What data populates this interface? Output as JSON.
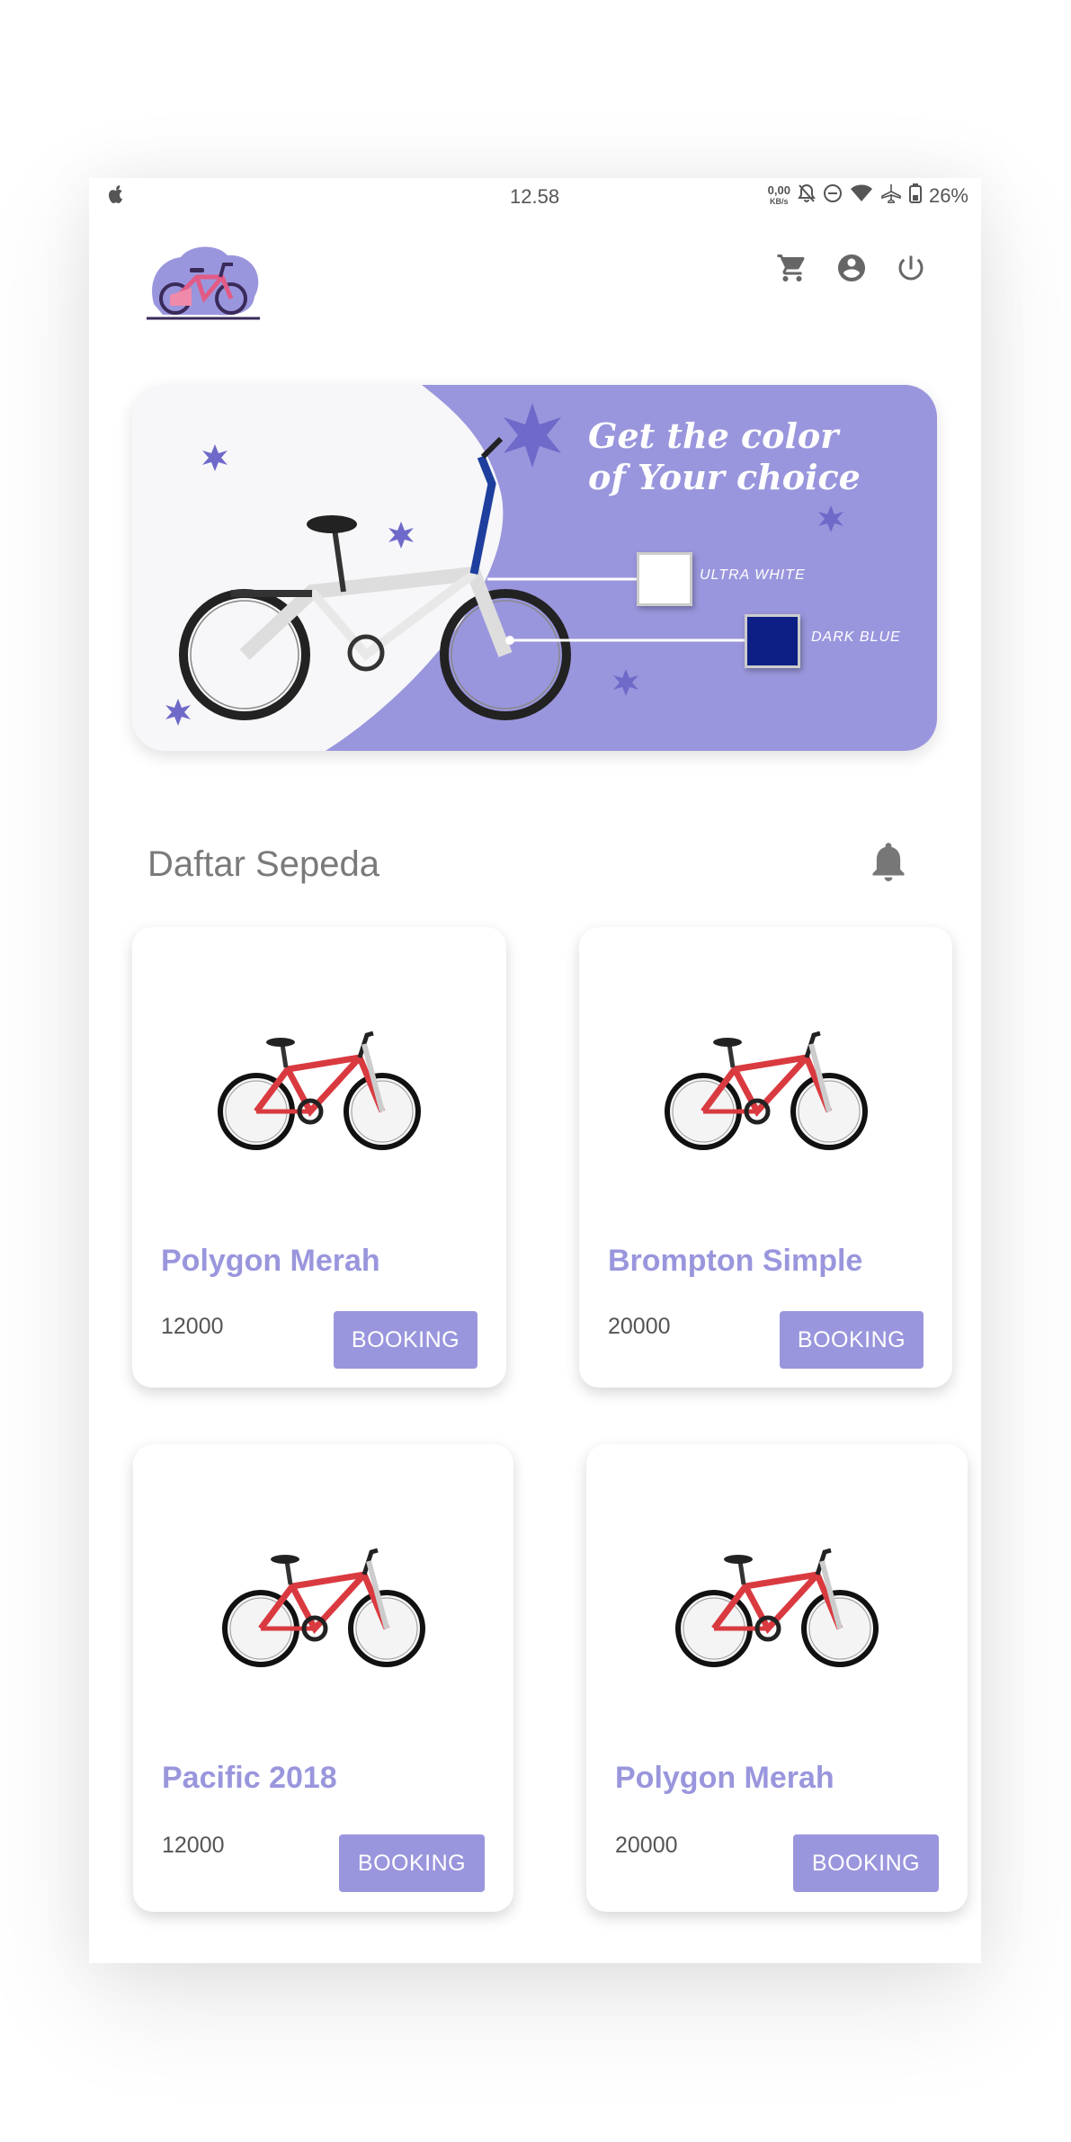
{
  "status_bar": {
    "time": "12.58",
    "net_speed_value": "0,00",
    "net_speed_unit": "KB/s",
    "battery": "26%"
  },
  "header": {
    "icons": [
      "cart-icon",
      "account-icon",
      "power-icon"
    ]
  },
  "banner": {
    "title_line1": "Get the color",
    "title_line2": "of Your choice",
    "options": [
      {
        "label": "ULTRA WHITE",
        "color": "#ffffff"
      },
      {
        "label": "DARK BLUE",
        "color": "#0d1f85"
      }
    ]
  },
  "section": {
    "title": "Daftar Sepeda"
  },
  "cards": [
    {
      "name": "Polygon Merah",
      "price": "12000",
      "button": "BOOKING"
    },
    {
      "name": "Brompton Simple",
      "price": "20000",
      "button": "BOOKING"
    },
    {
      "name": "Pacific 2018",
      "price": "12000",
      "button": "BOOKING"
    },
    {
      "name": "Polygon Merah",
      "price": "20000",
      "button": "BOOKING"
    }
  ],
  "colors": {
    "accent": "#9a96dd",
    "accent_dark": "#6f6ac9",
    "text_muted": "#7a7a7a"
  }
}
